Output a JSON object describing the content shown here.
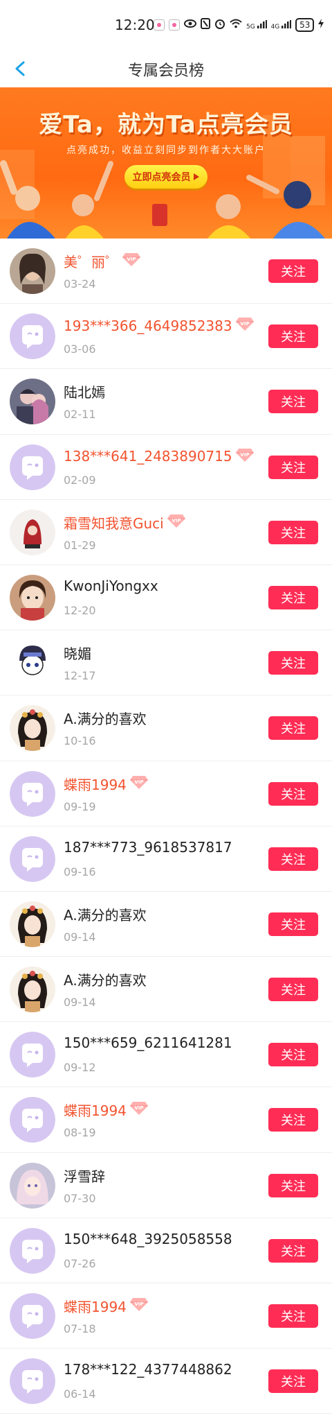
{
  "status_bar": {
    "time": "12:20",
    "network": "5G",
    "network2": "4G",
    "battery": "53"
  },
  "nav": {
    "title": "专属会员榜"
  },
  "banner": {
    "title": "爱Ta，就为Ta点亮会员",
    "subtitle": "点亮成功，收益立刻同步到作者大大账户",
    "button": "立即点亮会员"
  },
  "colors": {
    "accent": "#ff2d55",
    "vip_name": "#f2532f",
    "banner": "#ff6a12"
  },
  "list": {
    "follow_label": "关注",
    "rows": [
      {
        "name": "美゜丽゜",
        "date": "03-24",
        "vip": true,
        "avatar": "photo-woman"
      },
      {
        "name": "193***366_4649852383",
        "date": "03-06",
        "vip": true,
        "avatar": "default"
      },
      {
        "name": "陆北嫣",
        "date": "02-11",
        "vip": false,
        "avatar": "photo-couple"
      },
      {
        "name": "138***641_2483890715",
        "date": "02-09",
        "vip": true,
        "avatar": "default"
      },
      {
        "name": "霜雪知我意Guci",
        "date": "01-29",
        "vip": true,
        "avatar": "art-red"
      },
      {
        "name": "KwonJiYongxx",
        "date": "12-20",
        "vip": false,
        "avatar": "art-girl"
      },
      {
        "name": "晓媚",
        "date": "12-17",
        "vip": false,
        "avatar": "art-chibi"
      },
      {
        "name": "A.满分的喜欢",
        "date": "10-16",
        "vip": false,
        "avatar": "art-princess"
      },
      {
        "name": "蝶雨1994",
        "date": "09-19",
        "vip": true,
        "avatar": "default"
      },
      {
        "name": "187***773_9618537817",
        "date": "09-16",
        "vip": false,
        "avatar": "default"
      },
      {
        "name": "A.满分的喜欢",
        "date": "09-14",
        "vip": false,
        "avatar": "art-princess"
      },
      {
        "name": "A.满分的喜欢",
        "date": "09-14",
        "vip": false,
        "avatar": "art-princess"
      },
      {
        "name": "150***659_6211641281",
        "date": "09-12",
        "vip": false,
        "avatar": "default"
      },
      {
        "name": "蝶雨1994",
        "date": "08-19",
        "vip": true,
        "avatar": "default"
      },
      {
        "name": "浮雪辞",
        "date": "07-30",
        "vip": false,
        "avatar": "art-anime"
      },
      {
        "name": "150***648_3925058558",
        "date": "07-26",
        "vip": false,
        "avatar": "default"
      },
      {
        "name": "蝶雨1994",
        "date": "07-18",
        "vip": true,
        "avatar": "default"
      },
      {
        "name": "178***122_4377448862",
        "date": "06-14",
        "vip": false,
        "avatar": "default"
      }
    ]
  }
}
